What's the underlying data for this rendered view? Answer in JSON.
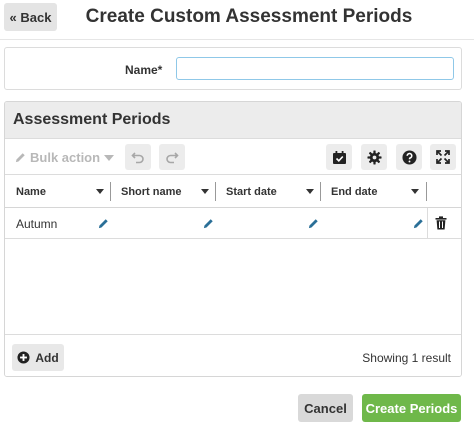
{
  "header": {
    "back_label": "« Back",
    "title": "Create Custom Assessment Periods"
  },
  "form": {
    "name_label": "Name*",
    "name_value": "",
    "name_placeholder": ""
  },
  "grid": {
    "title": "Assessment Periods",
    "toolbar": {
      "bulk_action_label": "Bulk action",
      "undo_icon": "undo-icon",
      "redo_icon": "redo-icon",
      "calendar_icon": "calendar-check-icon",
      "settings_icon": "gear-icon",
      "help_icon": "question-icon",
      "expand_icon": "expand-icon"
    },
    "columns": [
      "Name",
      "Short name",
      "Start date",
      "End date"
    ],
    "rows": [
      {
        "name": "Autumn",
        "short_name": "",
        "start_date": "",
        "end_date": ""
      }
    ],
    "footer": {
      "add_label": "Add",
      "showing_text": "Showing 1 result"
    }
  },
  "actions": {
    "cancel_label": "Cancel",
    "create_label": "Create Periods"
  },
  "colors": {
    "primary_green": "#6fb84a",
    "input_focus_border": "#8fc8e8",
    "pencil_blue": "#2a6f97",
    "panel_header_bg": "#ececec"
  }
}
